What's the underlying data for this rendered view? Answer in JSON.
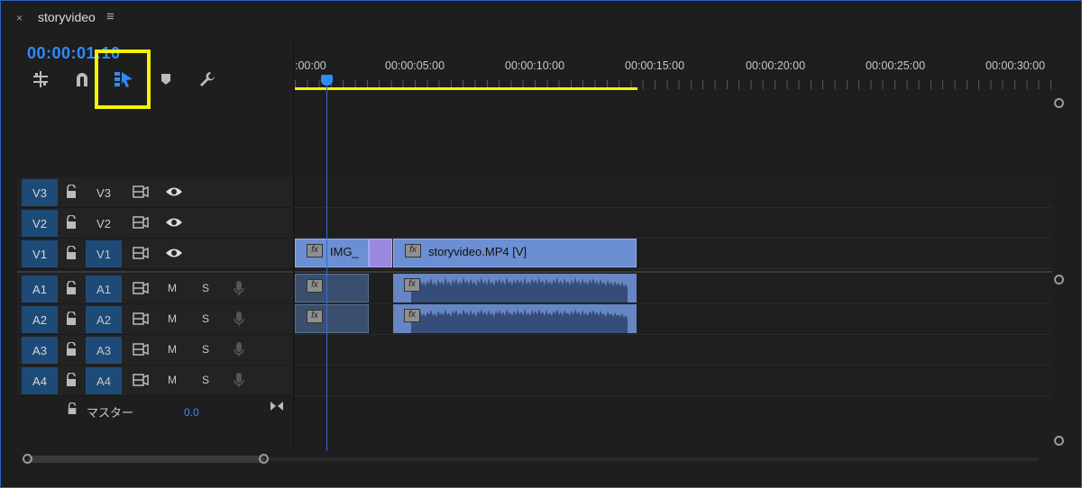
{
  "tab": {
    "title": "storyvideo",
    "close": "×",
    "menu": "≡"
  },
  "timecode": "00:00:01:10",
  "ruler": {
    "labels": [
      ":00:00",
      "00:00:05:00",
      "00:00:10:00",
      "00:00:15:00",
      "00:00:20:00",
      "00:00:25:00",
      "00:00:30:00"
    ]
  },
  "tracks": {
    "video": [
      {
        "src": "V3",
        "target": "V3",
        "target_on": false
      },
      {
        "src": "V2",
        "target": "V2",
        "target_on": false
      },
      {
        "src": "V1",
        "target": "V1",
        "target_on": true
      }
    ],
    "audio": [
      {
        "src": "A1",
        "target": "A1",
        "m": "M",
        "s": "S"
      },
      {
        "src": "A2",
        "target": "A2",
        "m": "M",
        "s": "S"
      },
      {
        "src": "A3",
        "target": "A3",
        "m": "M",
        "s": "S"
      },
      {
        "src": "A4",
        "target": "A4",
        "m": "M",
        "s": "S"
      }
    ]
  },
  "master": {
    "label": "マスター",
    "value": "0.0"
  },
  "clips": {
    "v1_img": "IMG_",
    "v1_main": "storyvideo.MP4 [V]",
    "fx": "fx"
  },
  "colors": {
    "accent": "#2f8cff",
    "highlight": "#f4f300",
    "clip_video": "#6b8fd2",
    "transition": "#9b87e0"
  }
}
